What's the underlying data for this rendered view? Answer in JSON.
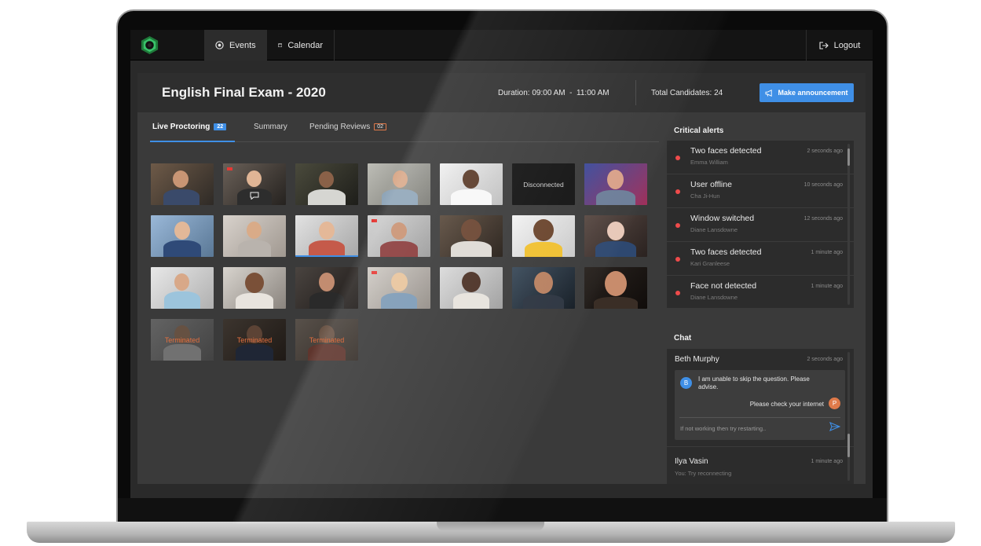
{
  "nav": {
    "tabs": [
      {
        "label": "Events",
        "icon": "target-icon",
        "active": true
      },
      {
        "label": "Calendar",
        "icon": "calendar-icon",
        "active": false
      }
    ],
    "logout_label": "Logout"
  },
  "header": {
    "exam_title": "English Final Exam - 2020",
    "duration_label": "Duration:",
    "duration_value": "09:00 AM  -  11:00 AM",
    "candidates_label": "Total Candidates:",
    "candidates_value": "24",
    "announce_label": "Make announcement"
  },
  "tabs": [
    {
      "label": "Live Proctoring",
      "badge": "22",
      "active": true
    },
    {
      "label": "Summary"
    },
    {
      "label": "Pending Reviews",
      "badge": "02"
    }
  ],
  "tile_states": {
    "disconnected": "Disconnected",
    "terminated": "Terminated"
  },
  "critical_alerts": {
    "title": "Critical alerts",
    "items": [
      {
        "title": "Two faces detected",
        "name": "Emma William",
        "time": "2 seconds ago"
      },
      {
        "title": "User offline",
        "name": "Cha Ji-Hun",
        "time": "10 seconds ago"
      },
      {
        "title": "Window switched",
        "name": "Diane Lansdowne",
        "time": "12 seconds ago"
      },
      {
        "title": "Two faces detected",
        "name": "Kari Granleese",
        "time": "1 minute ago"
      },
      {
        "title": "Face not detected",
        "name": "Diane Lansdowne",
        "time": "1 minute ago"
      }
    ]
  },
  "chat": {
    "title": "Chat",
    "active_thread": {
      "name": "Beth Murphy",
      "time": "2 seconds ago",
      "incoming_avatar": "B",
      "incoming": "I am unable to skip the question. Please advise.",
      "outgoing": "Please check your internet",
      "outgoing_avatar": "P",
      "input_value": "If not working then try restarting.."
    },
    "other_thread": {
      "name": "Ilya Vasin",
      "time": "1 minute ago",
      "preview": "You: Try reconnecting"
    }
  },
  "colors": {
    "accent": "#3f8fe6",
    "alert": "#ef4b4b",
    "warning": "#e07a4a"
  }
}
